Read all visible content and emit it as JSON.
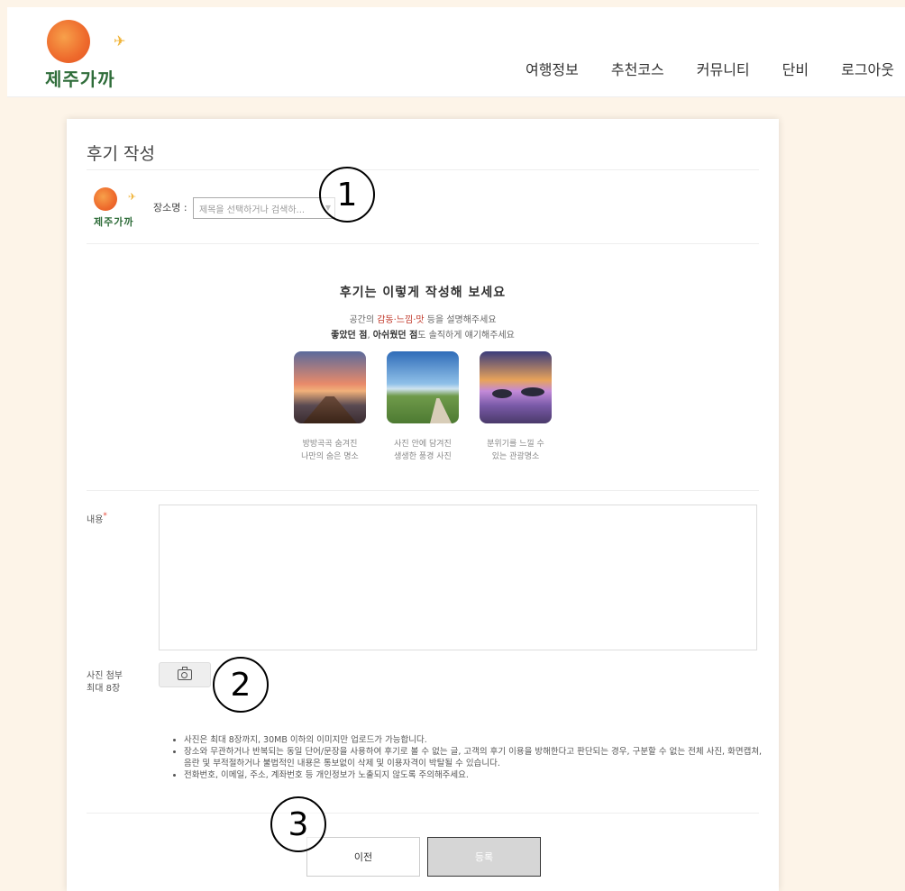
{
  "header": {
    "logo_text": "제주가까",
    "nav": [
      "여행정보",
      "추천코스",
      "커뮤니티",
      "단비",
      "로그아웃"
    ]
  },
  "form": {
    "title": "후기 작성",
    "mini_logo_text": "제주가까",
    "place_label": "장소명 :",
    "place_placeholder": "제목을 선택하거나 검색하..."
  },
  "guide": {
    "title": "후기는 이렇게 작성해 보세요",
    "line1_pre": "공간의 ",
    "line1_accent": "감동·느낌·맛",
    "line1_post": " 등을 설명해주세요",
    "line2_b1": "좋았던 점",
    "line2_mid": ", ",
    "line2_b2": "아쉬웠던 점",
    "line2_post": "도 솔직하게 얘기해주세요",
    "captions": [
      [
        "방방곡곡 숨겨진",
        "나만의 숨은 명소"
      ],
      [
        "사진 안에 담겨진",
        "생생한 풍경 사진"
      ],
      [
        "분위기를 느낄 수",
        "있는 관광명소"
      ]
    ]
  },
  "content": {
    "label": "내용",
    "required_mark": "*"
  },
  "attachment": {
    "label_line1": "사진 첨부",
    "label_line2": "최대 8장"
  },
  "notes": [
    "사진은 최대 8장까지, 30MB 이하의 이미지만 업로드가 가능합니다.",
    "장소와 무관하거나 반복되는 동일 단어/문장을 사용하여 후기로 볼 수 없는 글, 고객의 후기 이용을 방해한다고 판단되는 경우, 구분할 수 없는 전체 사진, 화면캡쳐, 음란 및 부적절하거나 불법적인 내용은 통보없이 삭제 및 이용자격이 박탈될 수 있습니다.",
    "전화번호, 이메일, 주소, 계좌번호 등 개인정보가 노출되지 않도록 주의해주세요."
  ],
  "buttons": {
    "prev": "이전",
    "submit": "등록"
  },
  "markers": [
    "1",
    "2",
    "3"
  ]
}
